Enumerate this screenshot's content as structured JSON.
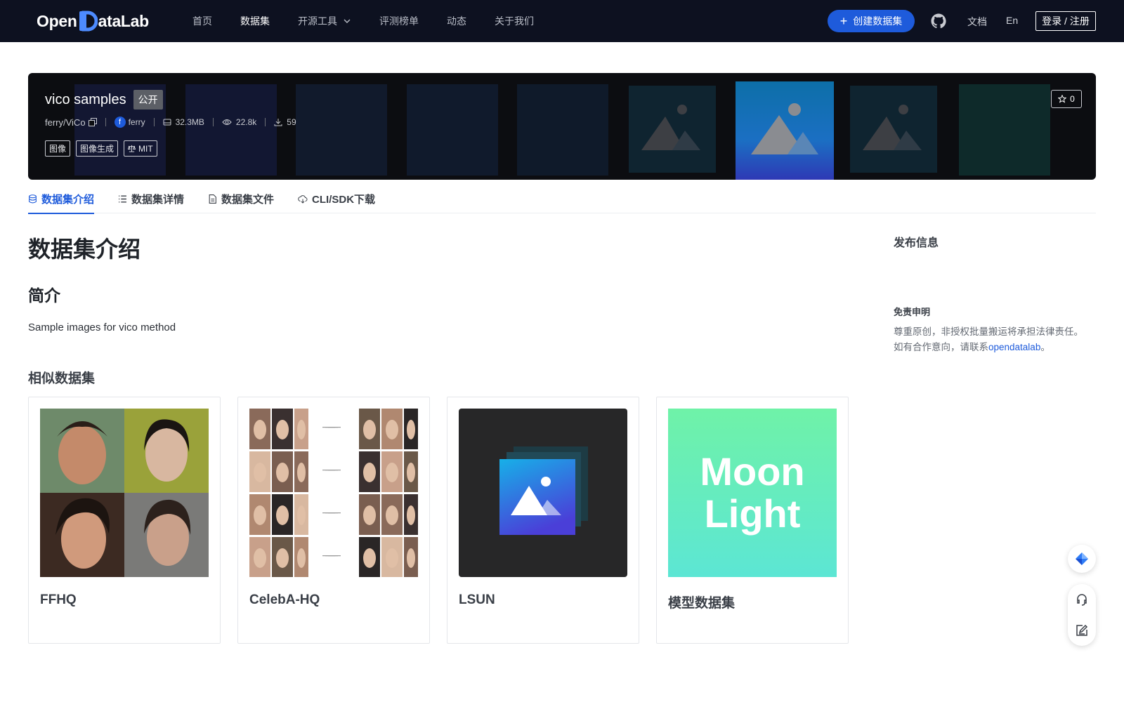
{
  "nav": {
    "logo_left": "Open",
    "logo_right": "ataLab",
    "links": [
      "首页",
      "数据集",
      "开源工具",
      "评测榜单",
      "动态",
      "关于我们"
    ],
    "create_label": "创建数据集",
    "docs_label": "文档",
    "lang_label": "En",
    "login_label": "登录 / 注册"
  },
  "dataset": {
    "title": "vico samples",
    "visibility": "公开",
    "path": "ferry/ViCo",
    "owner_initial": "f",
    "owner": "ferry",
    "size": "32.3MB",
    "views": "22.8k",
    "downloads": "59",
    "tags": [
      "图像",
      "图像生成",
      "MIT"
    ],
    "stars": "0"
  },
  "tabs": [
    "数据集介绍",
    "数据集详情",
    "数据集文件",
    "CLI/SDK下载"
  ],
  "content": {
    "heading": "数据集介绍",
    "intro_heading": "简介",
    "intro_text": "Sample images for vico method",
    "similar_heading": "相似数据集",
    "similar": [
      {
        "name": "FFHQ"
      },
      {
        "name": "CelebA-HQ"
      },
      {
        "name": "LSUN"
      },
      {
        "name": "模型数据集",
        "image_text_1": "Moon",
        "image_text_2": "Light"
      }
    ]
  },
  "side": {
    "publish_title": "发布信息",
    "disclaimer_title": "免责申明",
    "disclaimer_line1": "尊重原创，非授权批量搬运将承担法律责任。",
    "disclaimer_line2_prefix": "如有合作意向，请联系",
    "disclaimer_link": "opendatalab",
    "disclaimer_line2_suffix": "。"
  },
  "colors": {
    "nav_bg": "#0d1120",
    "accent": "#1e5bdb",
    "banner_bg": "#0c0d11"
  }
}
